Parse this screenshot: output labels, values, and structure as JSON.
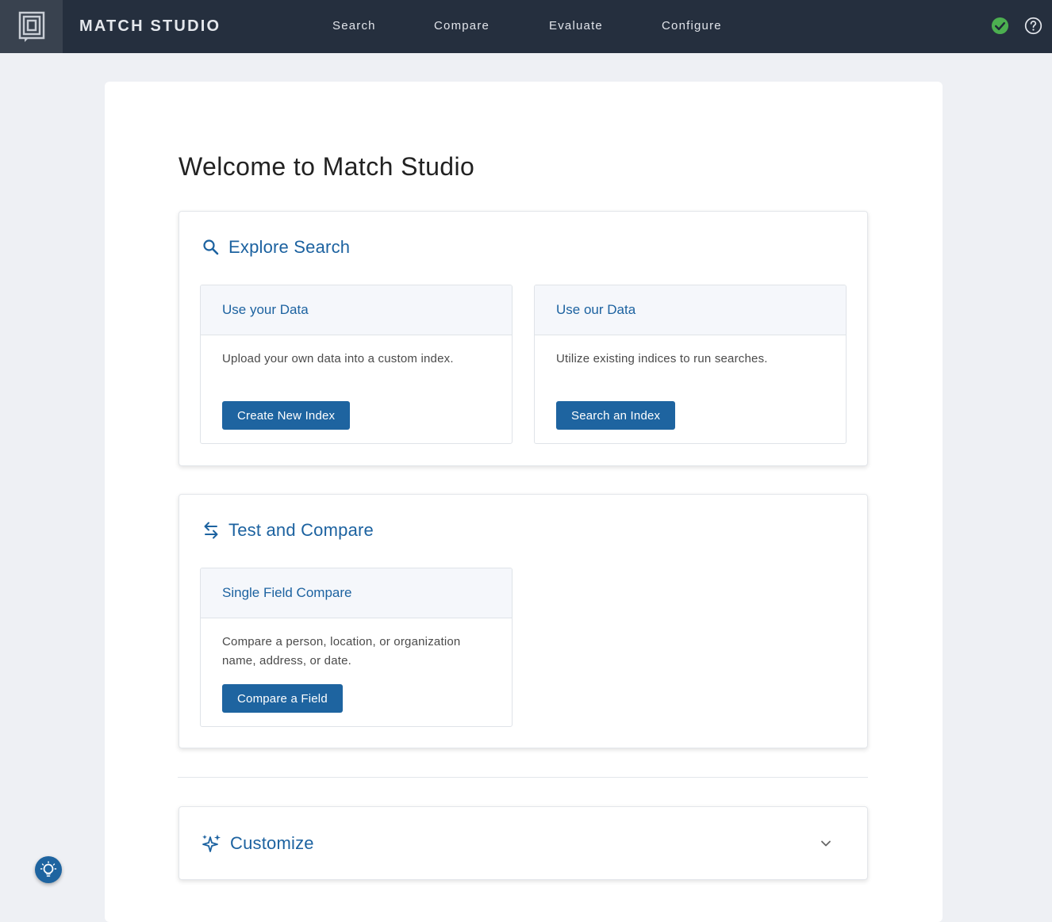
{
  "header": {
    "app_title": "MATCH STUDIO",
    "nav": [
      "Search",
      "Compare",
      "Evaluate",
      "Configure"
    ],
    "status_color": "#4caf50"
  },
  "main": {
    "page_title": "Welcome to Match Studio",
    "explore": {
      "title": "Explore Search",
      "cards": [
        {
          "title": "Use your Data",
          "text": "Upload your own data into a custom index.",
          "button": "Create New Index"
        },
        {
          "title": "Use our Data",
          "text": "Utilize existing indices to run searches.",
          "button": "Search an Index"
        }
      ]
    },
    "test": {
      "title": "Test and Compare",
      "card": {
        "title": "Single Field Compare",
        "text": "Compare a person, location, or organization name, address, or date.",
        "button": "Compare a Field"
      }
    },
    "customize": {
      "title": "Customize"
    }
  },
  "colors": {
    "accent": "#1e64a0",
    "topbar": "#252f3e"
  }
}
